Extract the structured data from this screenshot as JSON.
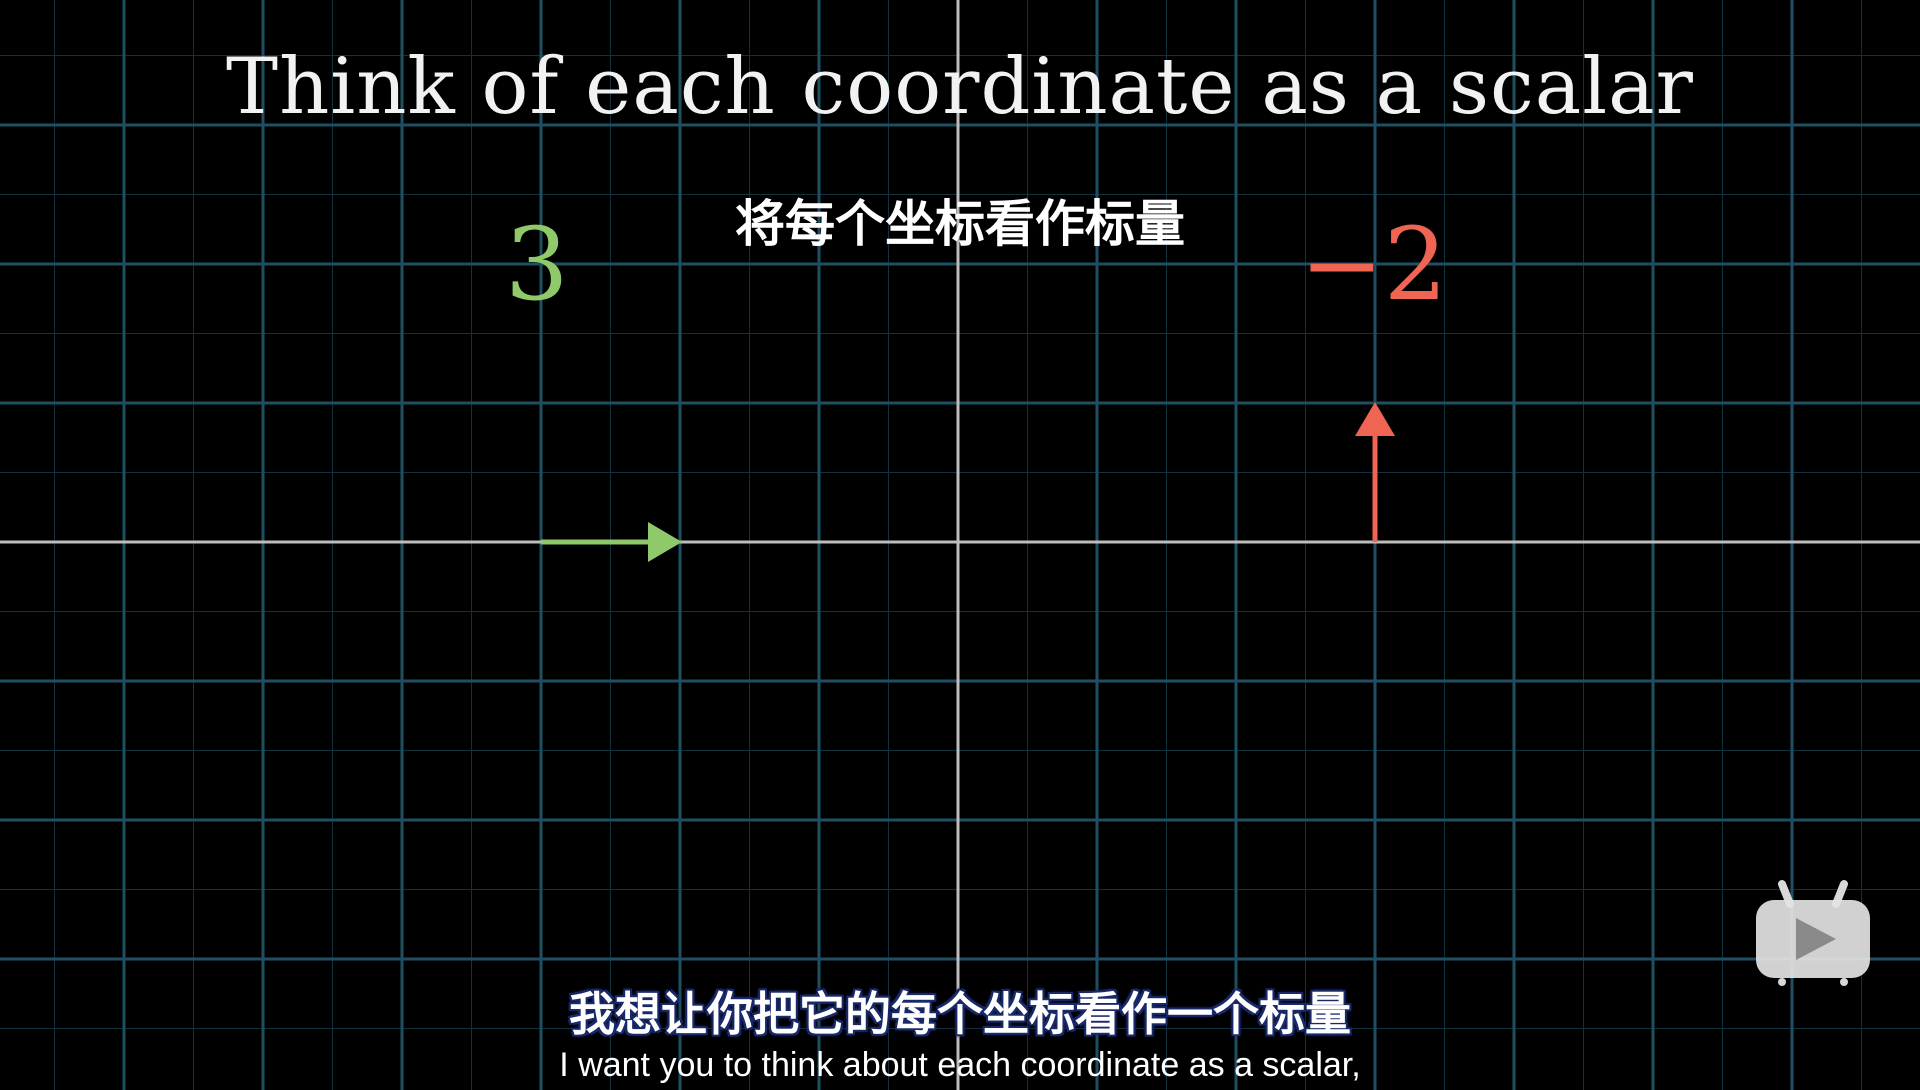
{
  "video": {
    "title_text": "Think of each coordinate as a scalar",
    "cn_overlay_title": "将每个坐标看作标量",
    "x_scalar": "3",
    "y_scalar": "−2",
    "subtitle_cn": "我想让你把它的每个坐标看作一个标量",
    "subtitle_en": "I want you to think about each coordinate as a scalar,"
  },
  "colors": {
    "background": "#000000",
    "grid_line": "#1f4f63",
    "axis": "#bdbdbd",
    "x_vector": "#8fc96a",
    "y_vector": "#f06454"
  },
  "icons": {
    "player_badge": "play-tv-icon"
  }
}
